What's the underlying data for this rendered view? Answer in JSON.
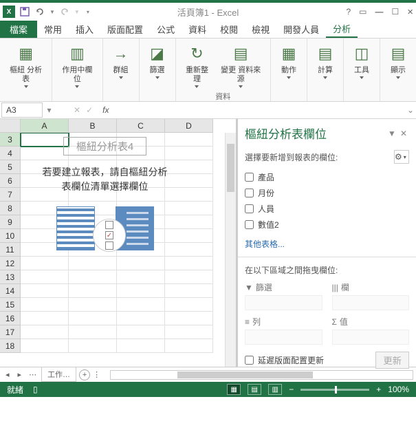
{
  "window": {
    "title": "活頁簿1 - Excel"
  },
  "tabs": {
    "file": "檔案",
    "list": [
      "常用",
      "插入",
      "版面配置",
      "公式",
      "資料",
      "校閱",
      "檢視",
      "開發人員"
    ],
    "contextual": "分析"
  },
  "ribbon": {
    "btns": [
      {
        "label": "樞紐\n分析表",
        "group": ""
      },
      {
        "label": "作用中欄位",
        "group": ""
      },
      {
        "label": "群組",
        "group": ""
      },
      {
        "label": "篩選",
        "group": ""
      },
      {
        "label": "重新整理",
        "group": ""
      },
      {
        "label": "變更\n資料來源",
        "group": ""
      },
      {
        "label": "動作",
        "group": ""
      },
      {
        "label": "計算",
        "group": ""
      },
      {
        "label": "工具",
        "group": ""
      },
      {
        "label": "顯示",
        "group": ""
      }
    ],
    "group_label": "資料"
  },
  "namebox": "A3",
  "fx_label": "fx",
  "columns": [
    "A",
    "B",
    "C",
    "D"
  ],
  "rows_start": 3,
  "rows_end": 18,
  "placeholder": {
    "title": "樞紐分析表4",
    "text1": "若要建立報表，請自樞紐分析",
    "text2": "表欄位清單選擇欄位"
  },
  "sheet_tabs": {
    "active": "工作…"
  },
  "pane": {
    "title": "樞紐分析表欄位",
    "subtitle": "選擇要新增到報表的欄位:",
    "fields": [
      "產品",
      "月份",
      "人員",
      "數值2"
    ],
    "more": "其他表格...",
    "drag_label": "在以下區域之間拖曳欄位:",
    "zones": {
      "filter": "篩選",
      "columns": "欄",
      "rows": "列",
      "values": "值"
    },
    "defer": "延遲版面配置更新",
    "update": "更新"
  },
  "status": {
    "ready": "就緒",
    "rec": "",
    "zoom": "100%"
  }
}
